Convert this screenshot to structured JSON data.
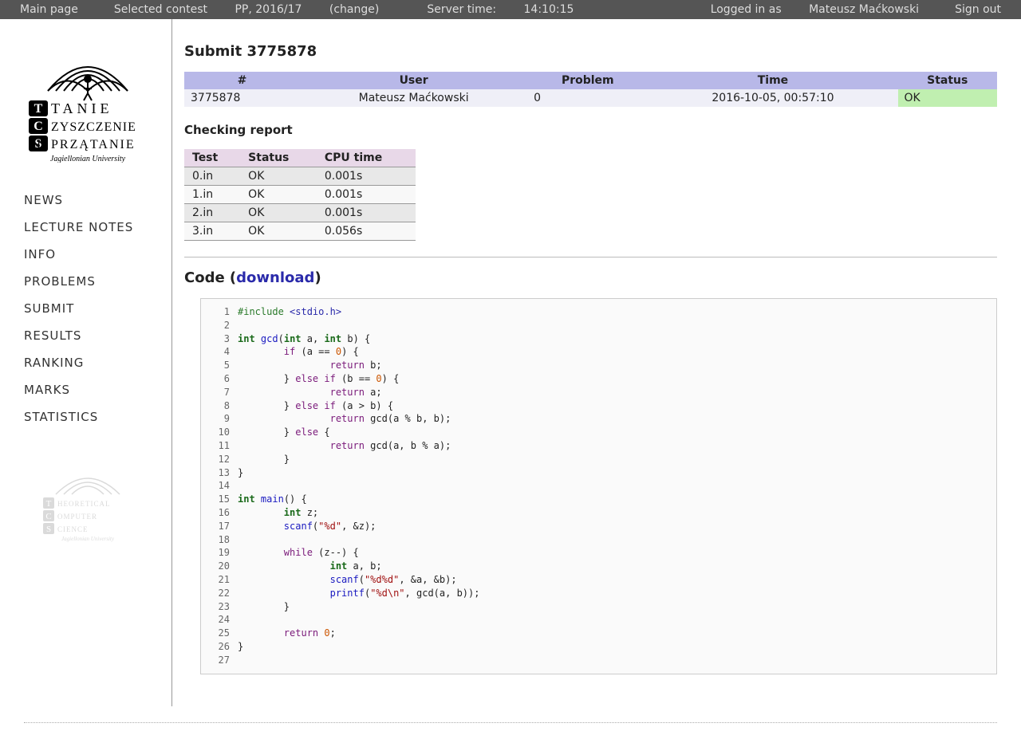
{
  "topbar": {
    "main_page": "Main page",
    "contest_prefix": "Selected contest ",
    "contest_name": "PP, 2016/17",
    "change_label": " (change)",
    "server_time_label": "Server time: ",
    "server_time": "14:10:15",
    "logged_in_prefix": "Logged in as ",
    "user": "Mateusz Maćkowski",
    "sign_out": "Sign out"
  },
  "logo": {
    "line1": "TANIE",
    "line2": "ZYSZCZENIE",
    "line3": "PRZĄTANIE",
    "univ": "Jagiellonian University"
  },
  "footer_logo": {
    "line1": "HEORETICAL",
    "line2": "OMPUTER",
    "line3": "CIENCE",
    "univ": "Jagiellonian University"
  },
  "nav": [
    "NEWS",
    "LECTURE NOTES",
    "INFO",
    "PROBLEMS",
    "SUBMIT",
    "RESULTS",
    "RANKING",
    "MARKS",
    "STATISTICS"
  ],
  "submit": {
    "heading_prefix": "Submit ",
    "id": "3775878",
    "columns": [
      "#",
      "User",
      "Problem",
      "Time",
      "Status"
    ],
    "row": {
      "id": "3775878",
      "user": "Mateusz Maćkowski",
      "problem": "0",
      "time": "2016-10-05, 00:57:10",
      "status": "OK"
    }
  },
  "checking": {
    "heading": "Checking report",
    "columns": [
      "Test",
      "Status",
      "CPU time"
    ],
    "rows": [
      {
        "test": "0.in",
        "status": "OK",
        "time": "0.001s"
      },
      {
        "test": "1.in",
        "status": "OK",
        "time": "0.001s"
      },
      {
        "test": "2.in",
        "status": "OK",
        "time": "0.001s"
      },
      {
        "test": "3.in",
        "status": "OK",
        "time": "0.056s"
      }
    ]
  },
  "code": {
    "heading_prefix": "Code (",
    "download": "download",
    "heading_suffix": ")",
    "lines": [
      [
        {
          "c": "pp",
          "t": "#include "
        },
        {
          "c": "inc",
          "t": "<stdio.h>"
        }
      ],
      [],
      [
        {
          "c": "type",
          "t": "int"
        },
        {
          "t": " "
        },
        {
          "c": "fn",
          "t": "gcd"
        },
        {
          "t": "("
        },
        {
          "c": "type",
          "t": "int"
        },
        {
          "t": " a, "
        },
        {
          "c": "type",
          "t": "int"
        },
        {
          "t": " b) {"
        }
      ],
      [
        {
          "t": "        "
        },
        {
          "c": "kw",
          "t": "if"
        },
        {
          "t": " (a == "
        },
        {
          "c": "num",
          "t": "0"
        },
        {
          "t": ") {"
        }
      ],
      [
        {
          "t": "                "
        },
        {
          "c": "kw",
          "t": "return"
        },
        {
          "t": " b;"
        }
      ],
      [
        {
          "t": "        } "
        },
        {
          "c": "kw",
          "t": "else if"
        },
        {
          "t": " (b == "
        },
        {
          "c": "num",
          "t": "0"
        },
        {
          "t": ") {"
        }
      ],
      [
        {
          "t": "                "
        },
        {
          "c": "kw",
          "t": "return"
        },
        {
          "t": " a;"
        }
      ],
      [
        {
          "t": "        } "
        },
        {
          "c": "kw",
          "t": "else if"
        },
        {
          "t": " (a > b) {"
        }
      ],
      [
        {
          "t": "                "
        },
        {
          "c": "kw",
          "t": "return"
        },
        {
          "t": " gcd(a % b, b);"
        }
      ],
      [
        {
          "t": "        } "
        },
        {
          "c": "kw",
          "t": "else"
        },
        {
          "t": " {"
        }
      ],
      [
        {
          "t": "                "
        },
        {
          "c": "kw",
          "t": "return"
        },
        {
          "t": " gcd(a, b % a);"
        }
      ],
      [
        {
          "t": "        }"
        }
      ],
      [
        {
          "t": "}"
        }
      ],
      [],
      [
        {
          "c": "type",
          "t": "int"
        },
        {
          "t": " "
        },
        {
          "c": "fn",
          "t": "main"
        },
        {
          "t": "() {"
        }
      ],
      [
        {
          "t": "        "
        },
        {
          "c": "type",
          "t": "int"
        },
        {
          "t": " z;"
        }
      ],
      [
        {
          "t": "        "
        },
        {
          "c": "fn",
          "t": "scanf"
        },
        {
          "t": "("
        },
        {
          "c": "str",
          "t": "\"%d\""
        },
        {
          "t": ", &z);"
        }
      ],
      [],
      [
        {
          "t": "        "
        },
        {
          "c": "kw",
          "t": "while"
        },
        {
          "t": " (z--) {"
        }
      ],
      [
        {
          "t": "                "
        },
        {
          "c": "type",
          "t": "int"
        },
        {
          "t": " a, b;"
        }
      ],
      [
        {
          "t": "                "
        },
        {
          "c": "fn",
          "t": "scanf"
        },
        {
          "t": "("
        },
        {
          "c": "str",
          "t": "\"%d%d\""
        },
        {
          "t": ", &a, &b);"
        }
      ],
      [
        {
          "t": "                "
        },
        {
          "c": "fn",
          "t": "printf"
        },
        {
          "t": "("
        },
        {
          "c": "str",
          "t": "\"%d\\n\""
        },
        {
          "t": ", gcd(a, b));"
        }
      ],
      [
        {
          "t": "        }"
        }
      ],
      [],
      [
        {
          "t": "        "
        },
        {
          "c": "kw",
          "t": "return"
        },
        {
          "t": " "
        },
        {
          "c": "num",
          "t": "0"
        },
        {
          "t": ";"
        }
      ],
      [
        {
          "t": "}"
        }
      ],
      []
    ]
  }
}
